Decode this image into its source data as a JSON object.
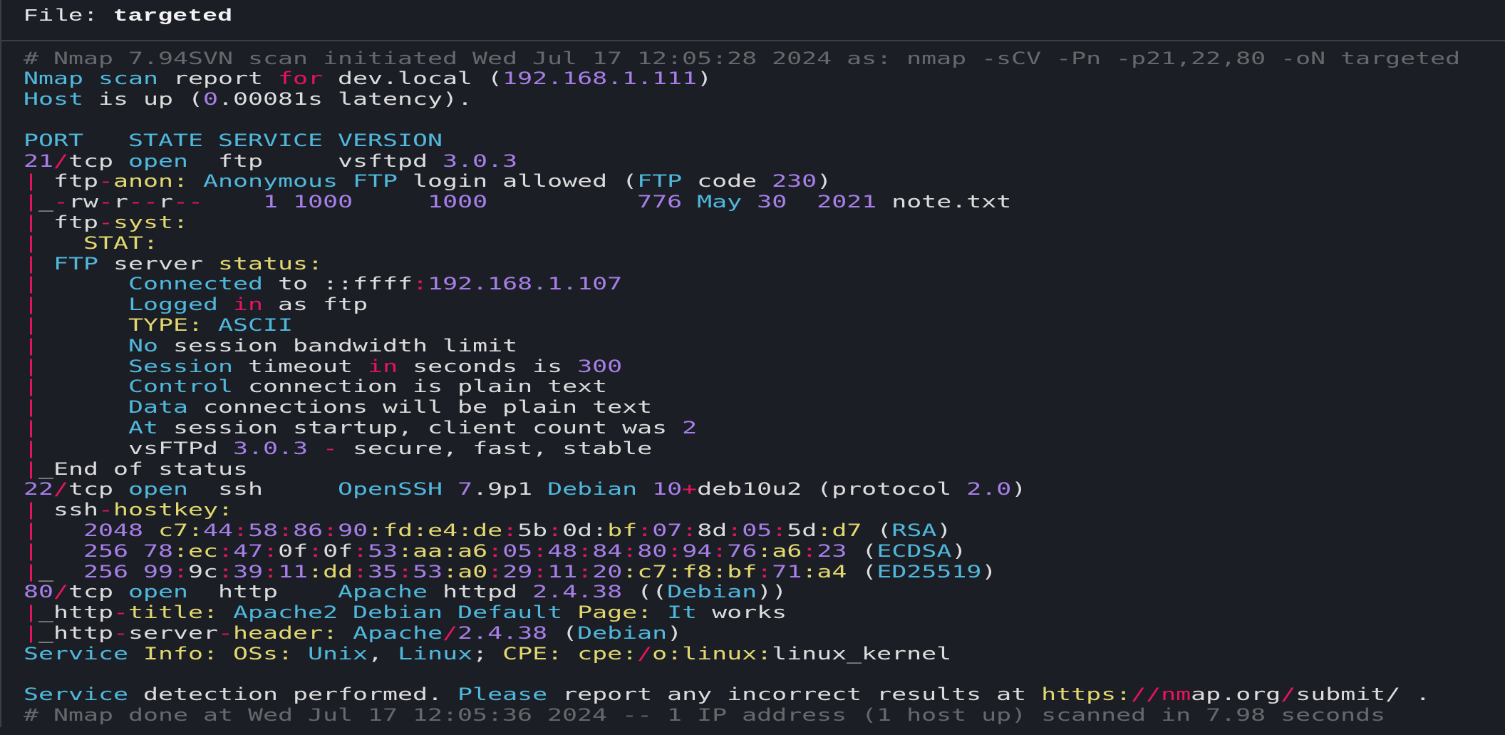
{
  "header": {
    "label": "File:",
    "filename": "targeted"
  },
  "token_types": {
    "c": "comment",
    "k": "keyword",
    "n": "number",
    "o": "operator",
    "s": "string",
    "p": "plain"
  },
  "colors": {
    "background": "#1c1e26",
    "comment": "#67686b",
    "keyword": "#4fb8dc",
    "number": "#a77fe8",
    "operator": "#e6145c",
    "string": "#e2d86e",
    "plain": "#dcdcdc"
  },
  "lines": [
    [
      [
        "# Nmap 7.94SVN scan initiated Wed Jul 17 12:05:28 2024 as: nmap -sCV -Pn -p21,22,80 -oN targeted",
        "c"
      ]
    ],
    [
      [
        "Nmap scan",
        "k"
      ],
      [
        " report ",
        "p"
      ],
      [
        "for",
        "o"
      ],
      [
        " dev.local (",
        "p"
      ],
      [
        "192.168.1.111",
        "n"
      ],
      [
        ")",
        "p"
      ]
    ],
    [
      [
        "Host",
        "k"
      ],
      [
        " is up (",
        "p"
      ],
      [
        "0",
        "n"
      ],
      [
        ".00081s latency).",
        "p"
      ]
    ],
    [],
    [
      [
        "PORT   STATE SERVICE VERSION",
        "k"
      ]
    ],
    [
      [
        "21",
        "n"
      ],
      [
        "/",
        "o"
      ],
      [
        "tcp ",
        "p"
      ],
      [
        "open",
        "k"
      ],
      [
        "  ftp     vsftpd ",
        "p"
      ],
      [
        "3.0.3",
        "n"
      ]
    ],
    [
      [
        "|",
        "o"
      ],
      [
        " ftp",
        "p"
      ],
      [
        "-",
        "o"
      ],
      [
        "anon:",
        "s"
      ],
      [
        " ",
        "p"
      ],
      [
        "Anonymous FTP",
        "k"
      ],
      [
        " login allowed (",
        "p"
      ],
      [
        "FTP",
        "k"
      ],
      [
        " code ",
        "p"
      ],
      [
        "230",
        "n"
      ],
      [
        ")",
        "p"
      ]
    ],
    [
      [
        "|",
        "o"
      ],
      [
        "_",
        "p"
      ],
      [
        "-",
        "o"
      ],
      [
        "rw",
        "p"
      ],
      [
        "-",
        "o"
      ],
      [
        "r",
        "p"
      ],
      [
        "--",
        "o"
      ],
      [
        "r",
        "p"
      ],
      [
        "--",
        "o"
      ],
      [
        "    ",
        "p"
      ],
      [
        "1 1000",
        "n"
      ],
      [
        "     ",
        "p"
      ],
      [
        "1000",
        "n"
      ],
      [
        "          ",
        "p"
      ],
      [
        "776",
        "n"
      ],
      [
        " ",
        "p"
      ],
      [
        "May",
        "k"
      ],
      [
        " ",
        "p"
      ],
      [
        "30",
        "n"
      ],
      [
        "  ",
        "p"
      ],
      [
        "2021",
        "n"
      ],
      [
        " note.txt",
        "p"
      ]
    ],
    [
      [
        "|",
        "o"
      ],
      [
        " ftp",
        "p"
      ],
      [
        "-",
        "o"
      ],
      [
        "syst:",
        "s"
      ]
    ],
    [
      [
        "|",
        "o"
      ],
      [
        "   ",
        "p"
      ],
      [
        "STAT:",
        "s"
      ]
    ],
    [
      [
        "|",
        "o"
      ],
      [
        " ",
        "p"
      ],
      [
        "FTP",
        "k"
      ],
      [
        " server ",
        "p"
      ],
      [
        "status:",
        "s"
      ]
    ],
    [
      [
        "|",
        "o"
      ],
      [
        "      ",
        "p"
      ],
      [
        "Connected",
        "k"
      ],
      [
        " to ::ffff",
        "p"
      ],
      [
        ":",
        "o"
      ],
      [
        "192.168.1.107",
        "n"
      ]
    ],
    [
      [
        "|",
        "o"
      ],
      [
        "      ",
        "p"
      ],
      [
        "Logged",
        "k"
      ],
      [
        " ",
        "p"
      ],
      [
        "in",
        "o"
      ],
      [
        " as ftp",
        "p"
      ]
    ],
    [
      [
        "|",
        "o"
      ],
      [
        "      ",
        "p"
      ],
      [
        "TYPE:",
        "s"
      ],
      [
        " ",
        "p"
      ],
      [
        "ASCII",
        "k"
      ]
    ],
    [
      [
        "|",
        "o"
      ],
      [
        "      ",
        "p"
      ],
      [
        "No",
        "k"
      ],
      [
        " session bandwidth limit",
        "p"
      ]
    ],
    [
      [
        "|",
        "o"
      ],
      [
        "      ",
        "p"
      ],
      [
        "Session",
        "k"
      ],
      [
        " timeout ",
        "p"
      ],
      [
        "in",
        "o"
      ],
      [
        " seconds is ",
        "p"
      ],
      [
        "300",
        "n"
      ]
    ],
    [
      [
        "|",
        "o"
      ],
      [
        "      ",
        "p"
      ],
      [
        "Control",
        "k"
      ],
      [
        " connection is plain text",
        "p"
      ]
    ],
    [
      [
        "|",
        "o"
      ],
      [
        "      ",
        "p"
      ],
      [
        "Data",
        "k"
      ],
      [
        " connections will be plain text",
        "p"
      ]
    ],
    [
      [
        "|",
        "o"
      ],
      [
        "      ",
        "p"
      ],
      [
        "At",
        "k"
      ],
      [
        " session startup, client count was ",
        "p"
      ],
      [
        "2",
        "n"
      ]
    ],
    [
      [
        "|",
        "o"
      ],
      [
        "      vsFTPd ",
        "p"
      ],
      [
        "3.0.3",
        "n"
      ],
      [
        " ",
        "p"
      ],
      [
        "-",
        "o"
      ],
      [
        " secure, fast, stable",
        "p"
      ]
    ],
    [
      [
        "|",
        "o"
      ],
      [
        "_End of status",
        "p"
      ]
    ],
    [
      [
        "22",
        "n"
      ],
      [
        "/",
        "o"
      ],
      [
        "tcp ",
        "p"
      ],
      [
        "open",
        "k"
      ],
      [
        "  ssh     ",
        "p"
      ],
      [
        "OpenSSH",
        "k"
      ],
      [
        " ",
        "p"
      ],
      [
        "7",
        "n"
      ],
      [
        ".9p1 ",
        "p"
      ],
      [
        "Debian",
        "k"
      ],
      [
        " ",
        "p"
      ],
      [
        "10",
        "n"
      ],
      [
        "+",
        "o"
      ],
      [
        "deb10u2 (protocol ",
        "p"
      ],
      [
        "2.0",
        "n"
      ],
      [
        ")",
        "p"
      ]
    ],
    [
      [
        "|",
        "o"
      ],
      [
        " ssh",
        "p"
      ],
      [
        "-",
        "o"
      ],
      [
        "hostkey:",
        "s"
      ]
    ],
    [
      [
        "|",
        "o"
      ],
      [
        "   ",
        "p"
      ],
      [
        "2048",
        "n"
      ],
      [
        " ",
        "p"
      ],
      [
        "c7:",
        "s"
      ],
      [
        "44",
        "n"
      ],
      [
        ":",
        "o"
      ],
      [
        "58",
        "n"
      ],
      [
        ":",
        "o"
      ],
      [
        "86",
        "n"
      ],
      [
        ":",
        "o"
      ],
      [
        "90",
        "n"
      ],
      [
        ":fd:e4:de",
        "s"
      ],
      [
        ":",
        "o"
      ],
      [
        "5b",
        "p"
      ],
      [
        ":",
        "o"
      ],
      [
        "0d:",
        "p"
      ],
      [
        "bf",
        "s"
      ],
      [
        ":",
        "o"
      ],
      [
        "07",
        "n"
      ],
      [
        ":",
        "o"
      ],
      [
        "8d",
        "p"
      ],
      [
        ":",
        "o"
      ],
      [
        "05",
        "n"
      ],
      [
        ":",
        "o"
      ],
      [
        "5d",
        "p"
      ],
      [
        ":d7",
        "s"
      ],
      [
        " (",
        "p"
      ],
      [
        "RSA",
        "k"
      ],
      [
        ")",
        "p"
      ]
    ],
    [
      [
        "|",
        "o"
      ],
      [
        "   ",
        "p"
      ],
      [
        "256",
        "n"
      ],
      [
        " ",
        "p"
      ],
      [
        "78",
        "n"
      ],
      [
        ":ec",
        "s"
      ],
      [
        ":",
        "o"
      ],
      [
        "47",
        "n"
      ],
      [
        ":",
        "o"
      ],
      [
        "0f",
        "p"
      ],
      [
        ":",
        "o"
      ],
      [
        "0f",
        "p"
      ],
      [
        ":",
        "o"
      ],
      [
        "53",
        "n"
      ],
      [
        ":aa:a6",
        "s"
      ],
      [
        ":",
        "o"
      ],
      [
        "05",
        "n"
      ],
      [
        ":",
        "o"
      ],
      [
        "48",
        "n"
      ],
      [
        ":",
        "o"
      ],
      [
        "84",
        "n"
      ],
      [
        ":",
        "o"
      ],
      [
        "80",
        "n"
      ],
      [
        ":",
        "o"
      ],
      [
        "94",
        "n"
      ],
      [
        ":",
        "o"
      ],
      [
        "76",
        "n"
      ],
      [
        ":a6",
        "s"
      ],
      [
        ":",
        "o"
      ],
      [
        "23",
        "n"
      ],
      [
        " (",
        "p"
      ],
      [
        "ECDSA",
        "k"
      ],
      [
        ")",
        "p"
      ]
    ],
    [
      [
        "|",
        "o"
      ],
      [
        "_  ",
        "p"
      ],
      [
        "256",
        "n"
      ],
      [
        " ",
        "p"
      ],
      [
        "99",
        "n"
      ],
      [
        ":",
        "o"
      ],
      [
        "9c",
        "p"
      ],
      [
        ":",
        "o"
      ],
      [
        "39",
        "n"
      ],
      [
        ":",
        "o"
      ],
      [
        "11",
        "n"
      ],
      [
        ":dd",
        "s"
      ],
      [
        ":",
        "o"
      ],
      [
        "35",
        "n"
      ],
      [
        ":",
        "o"
      ],
      [
        "53",
        "n"
      ],
      [
        ":a0",
        "s"
      ],
      [
        ":",
        "o"
      ],
      [
        "29",
        "n"
      ],
      [
        ":",
        "o"
      ],
      [
        "11",
        "n"
      ],
      [
        ":",
        "o"
      ],
      [
        "20",
        "n"
      ],
      [
        ":c7:f8:bf",
        "s"
      ],
      [
        ":",
        "o"
      ],
      [
        "71",
        "n"
      ],
      [
        ":a4",
        "s"
      ],
      [
        " (",
        "p"
      ],
      [
        "ED25519",
        "k"
      ],
      [
        ")",
        "p"
      ]
    ],
    [
      [
        "80",
        "n"
      ],
      [
        "/",
        "o"
      ],
      [
        "tcp ",
        "p"
      ],
      [
        "open",
        "k"
      ],
      [
        "  http    ",
        "p"
      ],
      [
        "Apache",
        "k"
      ],
      [
        " httpd ",
        "p"
      ],
      [
        "2.4.38",
        "n"
      ],
      [
        " ((",
        "p"
      ],
      [
        "Debian",
        "k"
      ],
      [
        "))",
        "p"
      ]
    ],
    [
      [
        "|",
        "o"
      ],
      [
        "_http",
        "p"
      ],
      [
        "-",
        "o"
      ],
      [
        "title:",
        "s"
      ],
      [
        " ",
        "p"
      ],
      [
        "Apache2 Debian Default",
        "k"
      ],
      [
        " ",
        "p"
      ],
      [
        "Page:",
        "s"
      ],
      [
        " ",
        "p"
      ],
      [
        "It",
        "k"
      ],
      [
        " works",
        "p"
      ]
    ],
    [
      [
        "|",
        "o"
      ],
      [
        "_http",
        "p"
      ],
      [
        "-",
        "o"
      ],
      [
        "server",
        "p"
      ],
      [
        "-",
        "o"
      ],
      [
        "header:",
        "s"
      ],
      [
        " ",
        "p"
      ],
      [
        "Apache",
        "k"
      ],
      [
        "/",
        "o"
      ],
      [
        "2.4.38",
        "n"
      ],
      [
        " (",
        "p"
      ],
      [
        "Debian",
        "k"
      ],
      [
        ")",
        "p"
      ]
    ],
    [
      [
        "Service",
        "k"
      ],
      [
        " ",
        "p"
      ],
      [
        "Info: OSs:",
        "s"
      ],
      [
        " ",
        "p"
      ],
      [
        "Unix",
        "k"
      ],
      [
        ", ",
        "p"
      ],
      [
        "Linux",
        "k"
      ],
      [
        "; ",
        "p"
      ],
      [
        "CPE: cpe:",
        "s"
      ],
      [
        "/",
        "o"
      ],
      [
        "o:linux:",
        "s"
      ],
      [
        "linux_kernel",
        "p"
      ]
    ],
    [],
    [
      [
        "Service",
        "k"
      ],
      [
        " detection performed. ",
        "p"
      ],
      [
        "Please",
        "k"
      ],
      [
        " report any incorrect results at ",
        "p"
      ],
      [
        "https:",
        "s"
      ],
      [
        "//nm",
        "o"
      ],
      [
        "ap.org",
        "p"
      ],
      [
        "/",
        "o"
      ],
      [
        "submit/ .",
        "p"
      ]
    ],
    [
      [
        "# Nmap done at Wed Jul 17 12:05:36 2024 -- 1 IP address (1 host up) scanned in 7.98 seconds",
        "c"
      ]
    ]
  ]
}
